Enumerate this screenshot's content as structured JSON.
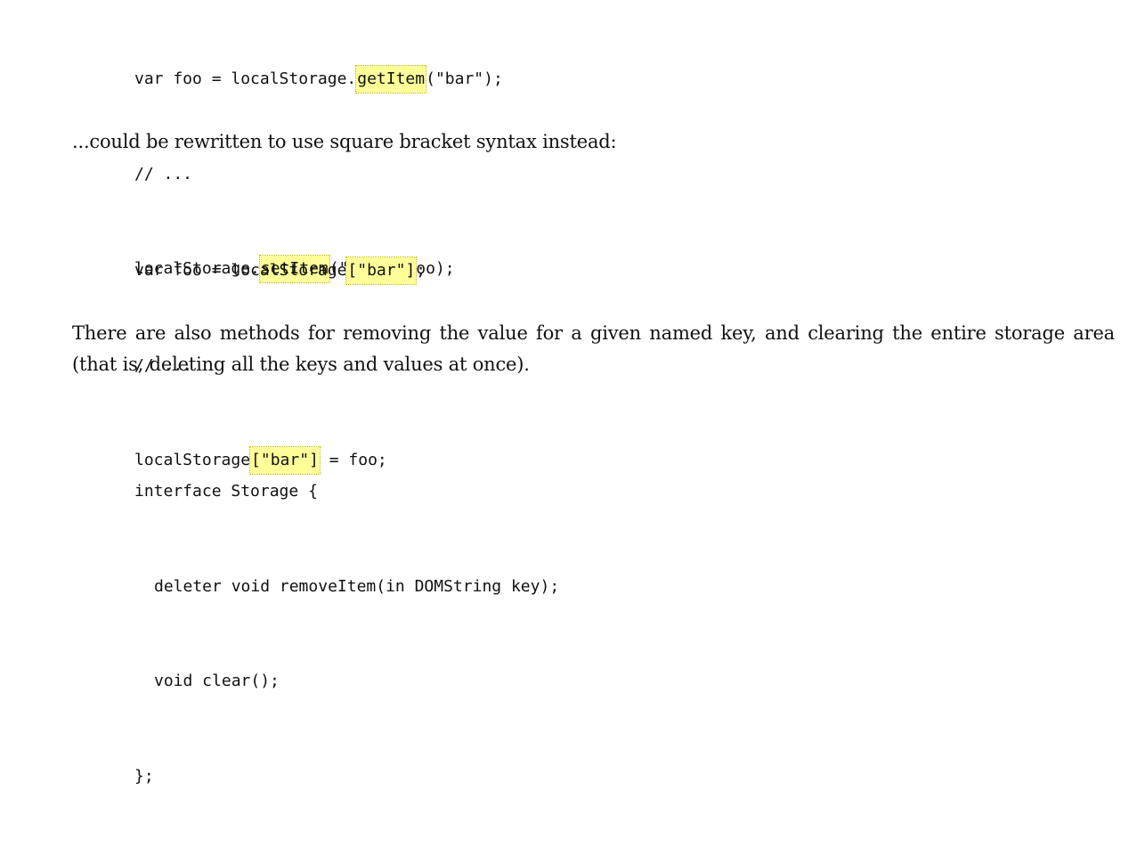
{
  "code_block_1": {
    "line1": {
      "a": "var foo = localStorage.",
      "hl": "getItem",
      "b": "(\"bar\");"
    },
    "line2": {
      "text": "// ..."
    },
    "line3": {
      "a": "localStorage.",
      "hl": "setItem",
      "b": "(\"bar\", foo);"
    }
  },
  "paragraph_1": "...could be rewritten to use square bracket syntax instead:",
  "code_block_2": {
    "line1": {
      "a": "var foo = localStorage",
      "hl": "[\"bar\"]",
      "b": ";"
    },
    "line2": {
      "text": "// ..."
    },
    "line3": {
      "a": "localStorage",
      "hl": "[\"bar\"]",
      "b": " = foo;"
    }
  },
  "paragraph_2": "There are also methods for removing the value for a given named key, and clearing the entire storage area (that is, deleting all the keys and values at once).",
  "code_block_3": {
    "line1": "interface Storage {",
    "line2": "deleter void removeItem(in DOMString key);",
    "line3": "void clear();",
    "line4": "};"
  },
  "colors": {
    "highlight": "#ffff99",
    "text": "#111111",
    "background": "#ffffff"
  }
}
